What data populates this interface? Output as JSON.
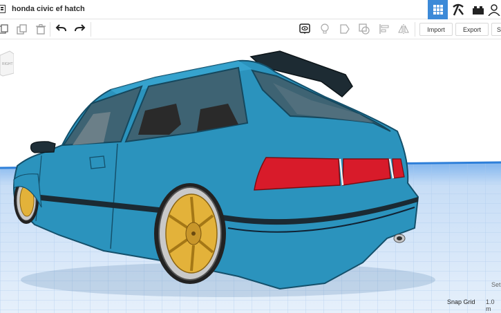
{
  "document": {
    "title": "honda civic ef hatch"
  },
  "toolbar": {
    "import_label": "Import",
    "export_label": "Export",
    "send_label": "Se"
  },
  "viewcube": {
    "face_label": "RIGHT"
  },
  "footer": {
    "settings_label": "Set",
    "snap_grid_label": "Snap Grid",
    "snap_grid_value": "1.0 m"
  },
  "colors": {
    "car_body": "#2b93bd",
    "tail_light": "#d81b2a",
    "rim": "#e3b23a",
    "grid_blue": "#2e7fd9",
    "accent": "#3c8ad8"
  },
  "icons": [
    "menu-icon",
    "grid-view-icon",
    "pickaxe-icon",
    "bricks-icon",
    "user-icon",
    "copy-icon",
    "duplicate-icon",
    "delete-icon",
    "undo-icon",
    "redo-icon",
    "view-toggle-icon",
    "light-bulb-icon",
    "shape-icon",
    "group-icon",
    "align-icon",
    "mirror-icon"
  ]
}
